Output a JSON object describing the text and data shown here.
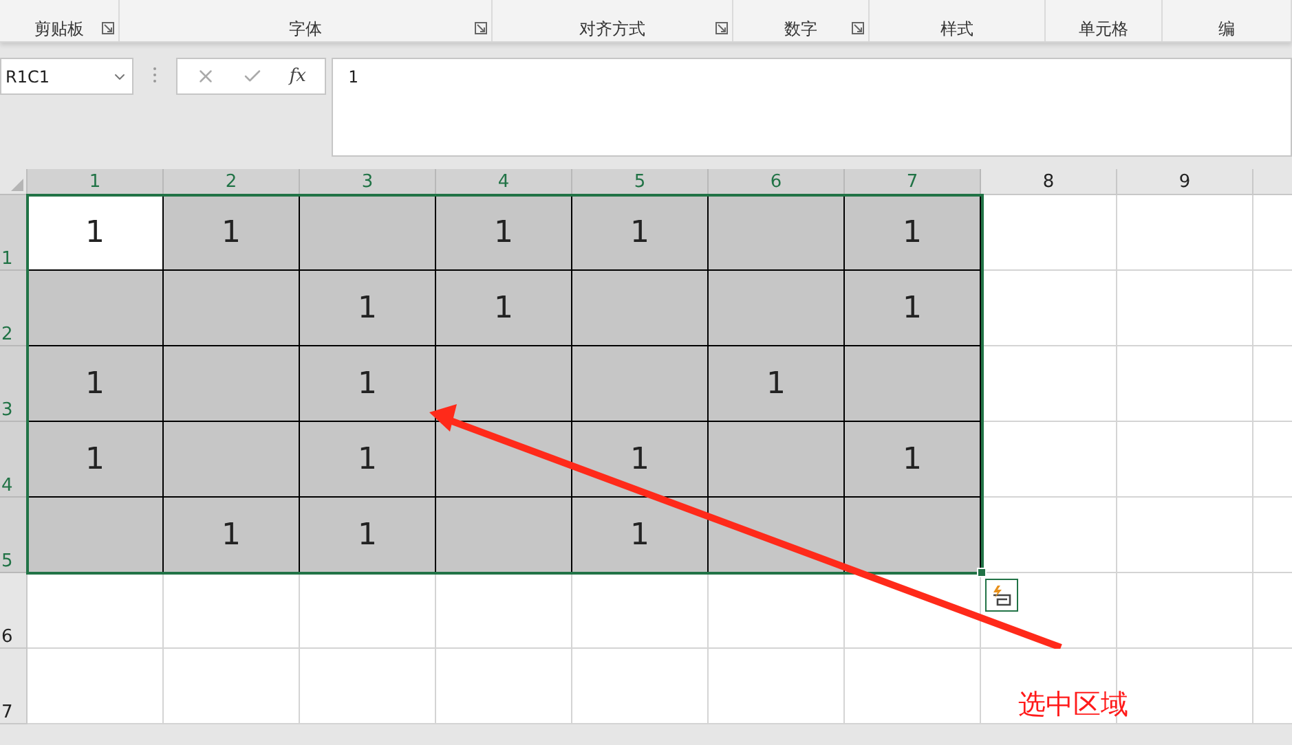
{
  "ribbon_groups": [
    {
      "label": "剪贴板",
      "launcher": true
    },
    {
      "label": "字体",
      "launcher": true
    },
    {
      "label": "对齐方式",
      "launcher": true
    },
    {
      "label": "数字",
      "launcher": true
    },
    {
      "label": "样式",
      "launcher": false
    },
    {
      "label": "单元格",
      "launcher": false
    },
    {
      "label": "编",
      "launcher": false
    }
  ],
  "name_box": {
    "value": "R1C1"
  },
  "formula_bar": {
    "fx": "fx",
    "value": "1"
  },
  "columns": [
    {
      "label": "1",
      "selected": true
    },
    {
      "label": "2",
      "selected": true
    },
    {
      "label": "3",
      "selected": true
    },
    {
      "label": "4",
      "selected": true
    },
    {
      "label": "5",
      "selected": true
    },
    {
      "label": "6",
      "selected": true
    },
    {
      "label": "7",
      "selected": true
    },
    {
      "label": "8",
      "selected": false
    },
    {
      "label": "9",
      "selected": false
    }
  ],
  "rows": [
    {
      "label": "1",
      "selected": true,
      "cells": [
        {
          "value": "1",
          "selected": true,
          "active": true
        },
        {
          "value": "1",
          "selected": true,
          "active": false
        },
        {
          "selected": true,
          "active": false
        },
        {
          "value": "1",
          "selected": true,
          "active": false
        },
        {
          "value": "1",
          "selected": true,
          "active": false
        },
        {
          "selected": true,
          "active": false
        },
        {
          "value": "1",
          "selected": true,
          "active": false
        },
        {
          "selected": false,
          "active": false
        },
        {
          "selected": false,
          "active": false
        }
      ]
    },
    {
      "label": "2",
      "selected": true,
      "cells": [
        {
          "selected": true,
          "active": false
        },
        {
          "selected": true,
          "active": false
        },
        {
          "value": "1",
          "selected": true,
          "active": false
        },
        {
          "value": "1",
          "selected": true,
          "active": false
        },
        {
          "selected": true,
          "active": false
        },
        {
          "selected": true,
          "active": false
        },
        {
          "value": "1",
          "selected": true,
          "active": false
        },
        {
          "selected": false,
          "active": false
        },
        {
          "selected": false,
          "active": false
        }
      ]
    },
    {
      "label": "3",
      "selected": true,
      "cells": [
        {
          "value": "1",
          "selected": true,
          "active": false
        },
        {
          "selected": true,
          "active": false
        },
        {
          "value": "1",
          "selected": true,
          "active": false
        },
        {
          "selected": true,
          "active": false
        },
        {
          "selected": true,
          "active": false
        },
        {
          "value": "1",
          "selected": true,
          "active": false
        },
        {
          "selected": true,
          "active": false
        },
        {
          "selected": false,
          "active": false
        },
        {
          "selected": false,
          "active": false
        }
      ]
    },
    {
      "label": "4",
      "selected": true,
      "cells": [
        {
          "value": "1",
          "selected": true,
          "active": false
        },
        {
          "selected": true,
          "active": false
        },
        {
          "value": "1",
          "selected": true,
          "active": false
        },
        {
          "selected": true,
          "active": false
        },
        {
          "value": "1",
          "selected": true,
          "active": false
        },
        {
          "selected": true,
          "active": false
        },
        {
          "value": "1",
          "selected": true,
          "active": false
        },
        {
          "selected": false,
          "active": false
        },
        {
          "selected": false,
          "active": false
        }
      ]
    },
    {
      "label": "5",
      "selected": true,
      "cells": [
        {
          "selected": true,
          "active": false
        },
        {
          "value": "1",
          "selected": true,
          "active": false
        },
        {
          "value": "1",
          "selected": true,
          "active": false
        },
        {
          "selected": true,
          "active": false
        },
        {
          "value": "1",
          "selected": true,
          "active": false
        },
        {
          "selected": true,
          "active": false
        },
        {
          "selected": true,
          "active": false
        },
        {
          "selected": false,
          "active": false
        },
        {
          "selected": false,
          "active": false
        }
      ]
    },
    {
      "label": "6",
      "selected": false,
      "cells": [
        {
          "selected": false,
          "active": false
        },
        {
          "selected": false,
          "active": false
        },
        {
          "selected": false,
          "active": false
        },
        {
          "selected": false,
          "active": false
        },
        {
          "selected": false,
          "active": false
        },
        {
          "selected": false,
          "active": false
        },
        {
          "selected": false,
          "active": false
        },
        {
          "selected": false,
          "active": false
        },
        {
          "selected": false,
          "active": false
        }
      ]
    },
    {
      "label": "7",
      "selected": false,
      "cells": [
        {
          "selected": false,
          "active": false
        },
        {
          "selected": false,
          "active": false
        },
        {
          "selected": false,
          "active": false
        },
        {
          "selected": false,
          "active": false
        },
        {
          "selected": false,
          "active": false
        },
        {
          "selected": false,
          "active": false
        },
        {
          "selected": false,
          "active": false
        },
        {
          "selected": false,
          "active": false
        },
        {
          "selected": false,
          "active": false
        }
      ]
    }
  ],
  "annotation": {
    "text": "选中区域"
  }
}
